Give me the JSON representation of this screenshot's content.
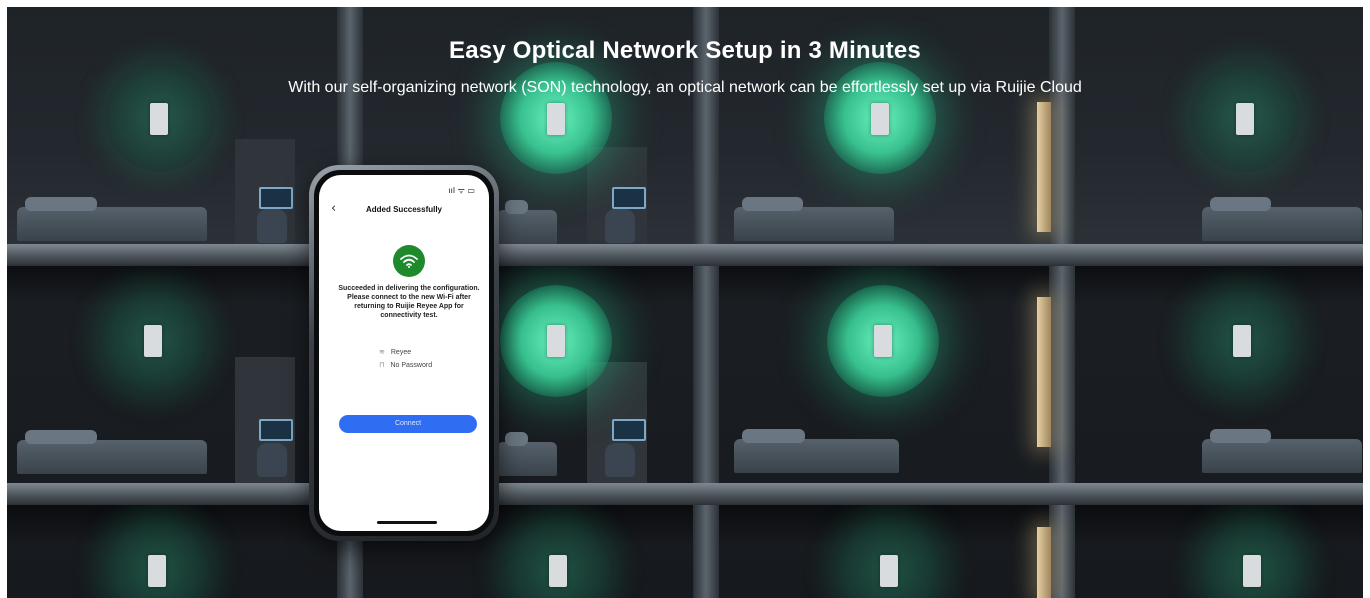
{
  "banner": {
    "title": "Easy Optical Network Setup in 3 Minutes",
    "subtitle": "With our self-organizing network (SON) technology, an optical network can be effortlessly set up via Ruijie Cloud"
  },
  "phone": {
    "status_icons": "ııl ᯤ ▭",
    "back_icon": "‹",
    "screen_title": "Added Successfully",
    "wifi_icon": "wifi-icon",
    "message": "Succeeded in delivering the configuration. Please connect to the new Wi-Fi after returning to Ruijie Reyee App for connectivity test.",
    "network_name": "Reyee",
    "password_status": "No Password",
    "connect_label": "Connect"
  },
  "colors": {
    "glow": "#3ddc9a",
    "connect_button": "#2f6df2",
    "success_badge": "#1f8a2c"
  }
}
